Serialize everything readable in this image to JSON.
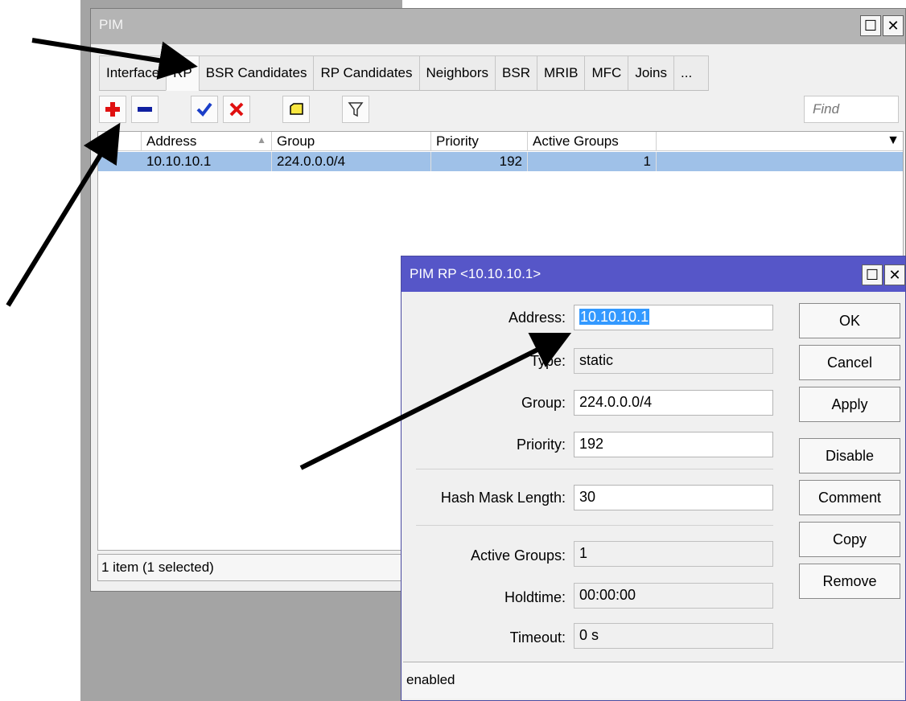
{
  "main_window": {
    "title": "PIM",
    "tabs": [
      {
        "label": "Interface"
      },
      {
        "label": "RP"
      },
      {
        "label": "BSR Candidates"
      },
      {
        "label": "RP Candidates"
      },
      {
        "label": "Neighbors"
      },
      {
        "label": "BSR"
      },
      {
        "label": "MRIB"
      },
      {
        "label": "MFC"
      },
      {
        "label": "Joins"
      },
      {
        "label": "..."
      }
    ],
    "active_tab": "RP",
    "find_placeholder": "Find",
    "columns": [
      "Address",
      "Group",
      "Priority",
      "Active Groups"
    ],
    "rows": [
      {
        "address": "10.10.10.1",
        "group": "224.0.0.0/4",
        "priority": "192",
        "active_groups": "1"
      }
    ],
    "status": "1 item (1 selected)",
    "toolbar_icons": [
      "add-icon",
      "remove-icon",
      "enable-icon",
      "disable-icon",
      "comment-icon",
      "filter-icon"
    ]
  },
  "dialog": {
    "title": "PIM RP <10.10.10.1>",
    "fields": {
      "address_label": "Address:",
      "address": "10.10.10.1",
      "type_label": "Type:",
      "type": "static",
      "group_label": "Group:",
      "group": "224.0.0.0/4",
      "priority_label": "Priority:",
      "priority": "192",
      "hash_label": "Hash Mask Length:",
      "hash": "30",
      "active_label": "Active Groups:",
      "active": "1",
      "holdtime_label": "Holdtime:",
      "holdtime": "00:00:00",
      "timeout_label": "Timeout:",
      "timeout": "0 s"
    },
    "buttons": [
      "OK",
      "Cancel",
      "Apply",
      "Disable",
      "Comment",
      "Copy",
      "Remove"
    ],
    "status": "enabled"
  },
  "colors": {
    "dialog_title": "#5656c8",
    "selected_row": "#9fc1e8",
    "add_icon": "#e01010",
    "remove_icon": "#1020a0",
    "check_icon": "#1a3ec8",
    "x_icon": "#e01010"
  }
}
